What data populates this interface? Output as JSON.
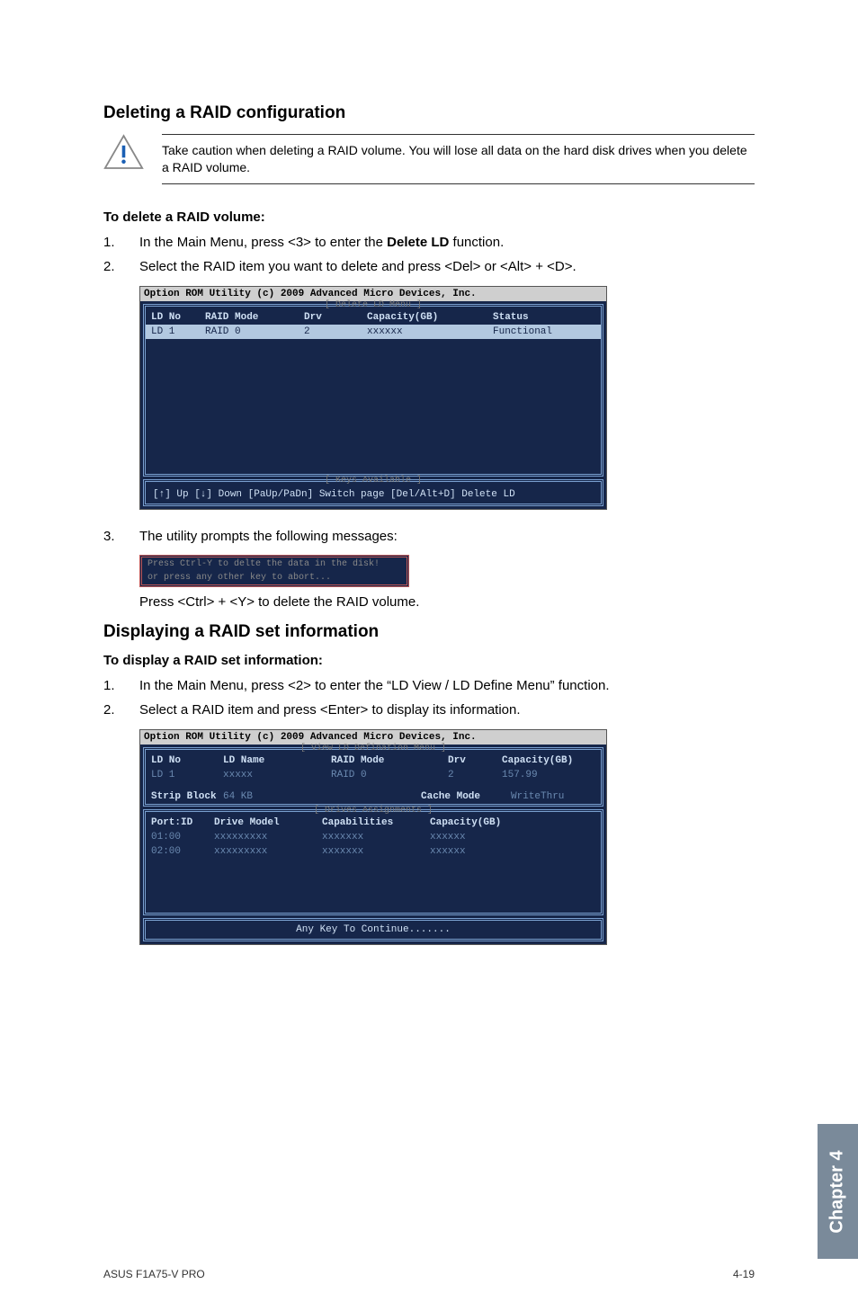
{
  "section1": {
    "title": "Deleting a RAID configuration",
    "notice": "Take caution when deleting a RAID volume. You will lose all data on the hard disk drives when you delete a RAID volume.",
    "subtitle": "To delete a RAID volume:",
    "step1_num": "1.",
    "step1_pre": "In the Main Menu, press <3> to enter the ",
    "step1_bold": "Delete LD",
    "step1_post": " function.",
    "step2_num": "2.",
    "step2": "Select the RAID item you want to delete and press <Del> or <Alt> + <D>.",
    "step3_num": "3.",
    "step3": "The utility prompts the following messages:",
    "prompt_line1": "Press Ctrl-Y to delte the data in the disk!",
    "prompt_line2": "or press any other key to abort...",
    "step3_after": "Press <Ctrl> + <Y> to delete the RAID volume."
  },
  "section2": {
    "title": "Displaying a RAID set information",
    "subtitle": "To display a RAID set information:",
    "step1_num": "1.",
    "step1": "In the Main Menu, press <2> to enter the “LD View / LD Define Menu” function.",
    "step2_num": "2.",
    "step2": "Select a RAID item and press <Enter> to display its information."
  },
  "bios1": {
    "title": "Option ROM Utility (c) 2009 Advanced Micro Devices, Inc.",
    "panel1_title": "[ Delete LD Menu ]",
    "h1": "LD No",
    "h2": "RAID Mode",
    "h3": "Drv",
    "h4": "Capacity(GB)",
    "h5": "Status",
    "r1": "LD  1",
    "r2": "RAID 0",
    "r3": "2",
    "r4": "xxxxxx",
    "r5": "Functional",
    "panel2_title": "[ Keys Available ]",
    "keys": "[↑] Up  [↓] Down  [PaUp/PaDn] Switch page  [Del/Alt+D] Delete LD"
  },
  "bios2": {
    "title": "Option ROM Utility (c) 2009 Advanced Micro Devices, Inc.",
    "panel1_title": "[ View LD Defination Menu ]",
    "h1": "LD No",
    "h2": "LD Name",
    "h3": "RAID Mode",
    "h4": "Drv",
    "h5": "Capacity(GB)",
    "r1": "LD  1",
    "r2": "xxxxx",
    "r3": "RAID 0",
    "r4": "2",
    "r5": "157.99",
    "s1": "Strip Block",
    "s2": "64 KB",
    "s3": "Cache Mode",
    "s4": "WriteThru",
    "panel2_title": "[ Drives Assignments ]",
    "dh1": "Port:ID",
    "dh2": "Drive Model",
    "dh3": "Capabilities",
    "dh4": "Capacity(GB)",
    "d1a": "01:00",
    "d1b": "xxxxxxxxx",
    "d1c": "xxxxxxx",
    "d1d": "xxxxxx",
    "d2a": "02:00",
    "d2b": "xxxxxxxxx",
    "d2c": "xxxxxxx",
    "d2d": "xxxxxx",
    "foot": "Any Key To Continue......."
  },
  "side": "Chapter 4",
  "footer_left": "ASUS F1A75-V PRO",
  "footer_right": "4-19"
}
